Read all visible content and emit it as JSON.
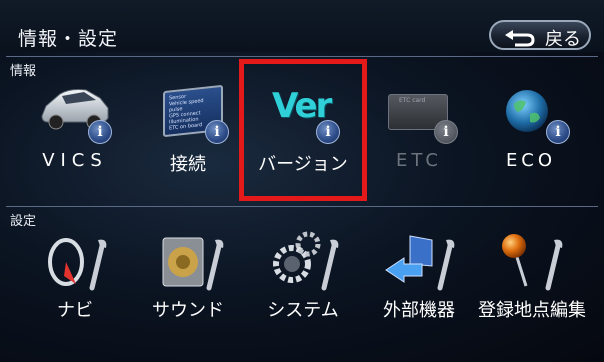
{
  "header": {
    "title": "情報・設定",
    "back_label": "戻る"
  },
  "sections": {
    "info_label": "情報",
    "settings_label": "設定"
  },
  "info_items": [
    {
      "label": "VICS",
      "icon": "car-icon",
      "enabled": true
    },
    {
      "label": "接続",
      "icon": "connection-screen-icon",
      "enabled": true
    },
    {
      "label": "バージョン",
      "icon": "ver-icon",
      "enabled": true,
      "highlighted": true
    },
    {
      "label": "ETC",
      "icon": "etc-card-icon",
      "enabled": false
    },
    {
      "label": "ECO",
      "icon": "globe-icon",
      "enabled": true
    }
  ],
  "settings_items": [
    {
      "label": "ナビ",
      "icon": "navi-compass-icon"
    },
    {
      "label": "サウンド",
      "icon": "speaker-icon"
    },
    {
      "label": "システム",
      "icon": "gears-icon"
    },
    {
      "label": "外部機器",
      "icon": "external-device-icon"
    },
    {
      "label": "登録地点編集",
      "icon": "map-pin-icon"
    }
  ],
  "icons_text": {
    "ver": "Ver",
    "info": "i",
    "etc_card": "ETC card"
  },
  "connection_screen_lines": [
    "Sensor",
    "Vehicle speed pulse",
    "GPS connect",
    "Illumination",
    "ETC on board"
  ],
  "colors": {
    "highlight": "#e41a1a",
    "background": "#0b1422",
    "accent": "#2b4a86"
  }
}
